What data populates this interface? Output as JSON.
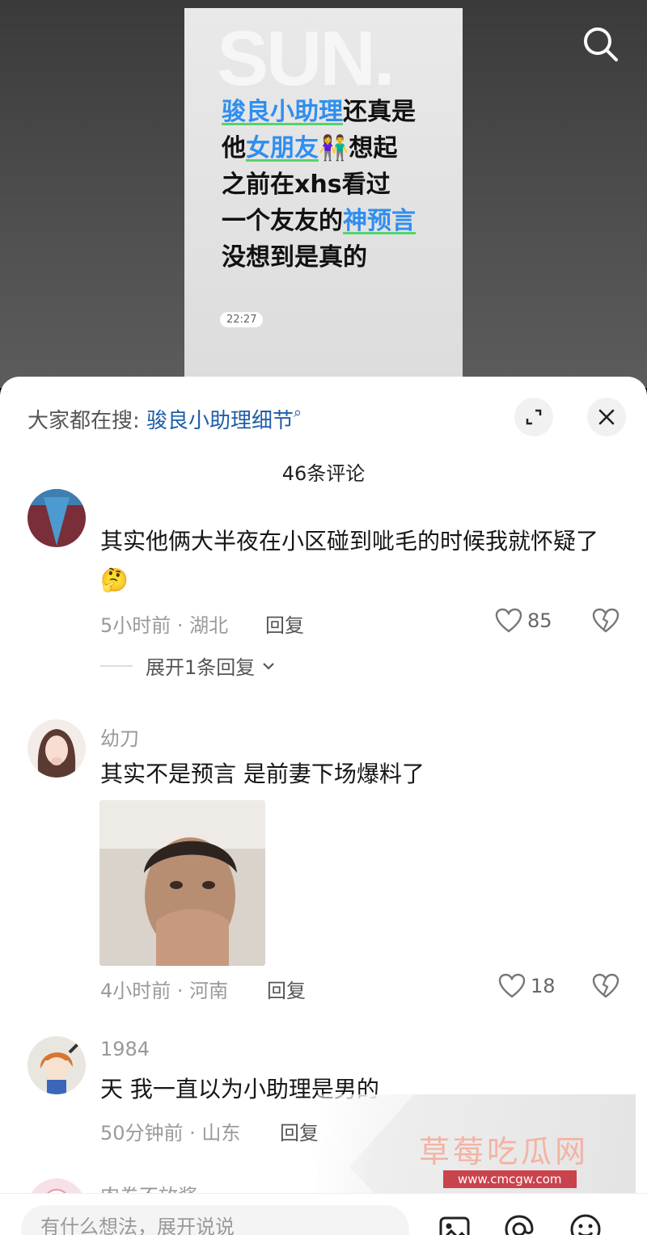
{
  "video": {
    "brand_text": "SUN.",
    "overlay_lines": [
      [
        {
          "t": "骏良小助理",
          "hl": true
        },
        {
          "t": "还真是",
          "hl": false
        }
      ],
      [
        {
          "t": "他",
          "hl": false
        },
        {
          "t": "女朋友",
          "hl": true
        },
        {
          "t": "👫想起",
          "hl": false
        }
      ],
      [
        {
          "t": "之前在xhs看过",
          "hl": false
        }
      ],
      [
        {
          "t": "一个友友的",
          "hl": false
        },
        {
          "t": "神预言",
          "hl": true
        }
      ],
      [
        {
          "t": "没想到是真的",
          "hl": false
        }
      ]
    ],
    "timestamp": "22:27"
  },
  "sheet": {
    "everyone_search_prefix": "大家都在搜: ",
    "everyone_search_term": "骏良小助理细节",
    "comment_count": "46条评论"
  },
  "comments": [
    {
      "username": "",
      "text": "其实他俩大半夜在小区碰到呲毛的时候我就怀疑了🤔",
      "meta": "5小时前 · 湖北",
      "reply_label": "回复",
      "likes": "85",
      "expand_replies": "展开1条回复"
    },
    {
      "username": "幼刀",
      "text": "其实不是预言 是前妻下场爆料了",
      "meta": "4小时前 · 河南",
      "reply_label": "回复",
      "likes": "18"
    },
    {
      "username": "1984",
      "text": "天 我一直以为小助理是男的",
      "meta": "50分钟前 · 山东",
      "reply_label": "回复"
    },
    {
      "username": "肉卷不放酱"
    }
  ],
  "watermark": {
    "title": "草莓吃瓜网",
    "url": "www.cmcgw.com"
  },
  "input": {
    "placeholder": "有什么想法，展开说说"
  },
  "colors": {
    "highlight_blue": "#2f8ef0",
    "underline_green": "#55d36a",
    "search_term_blue": "#1e5ea8"
  }
}
